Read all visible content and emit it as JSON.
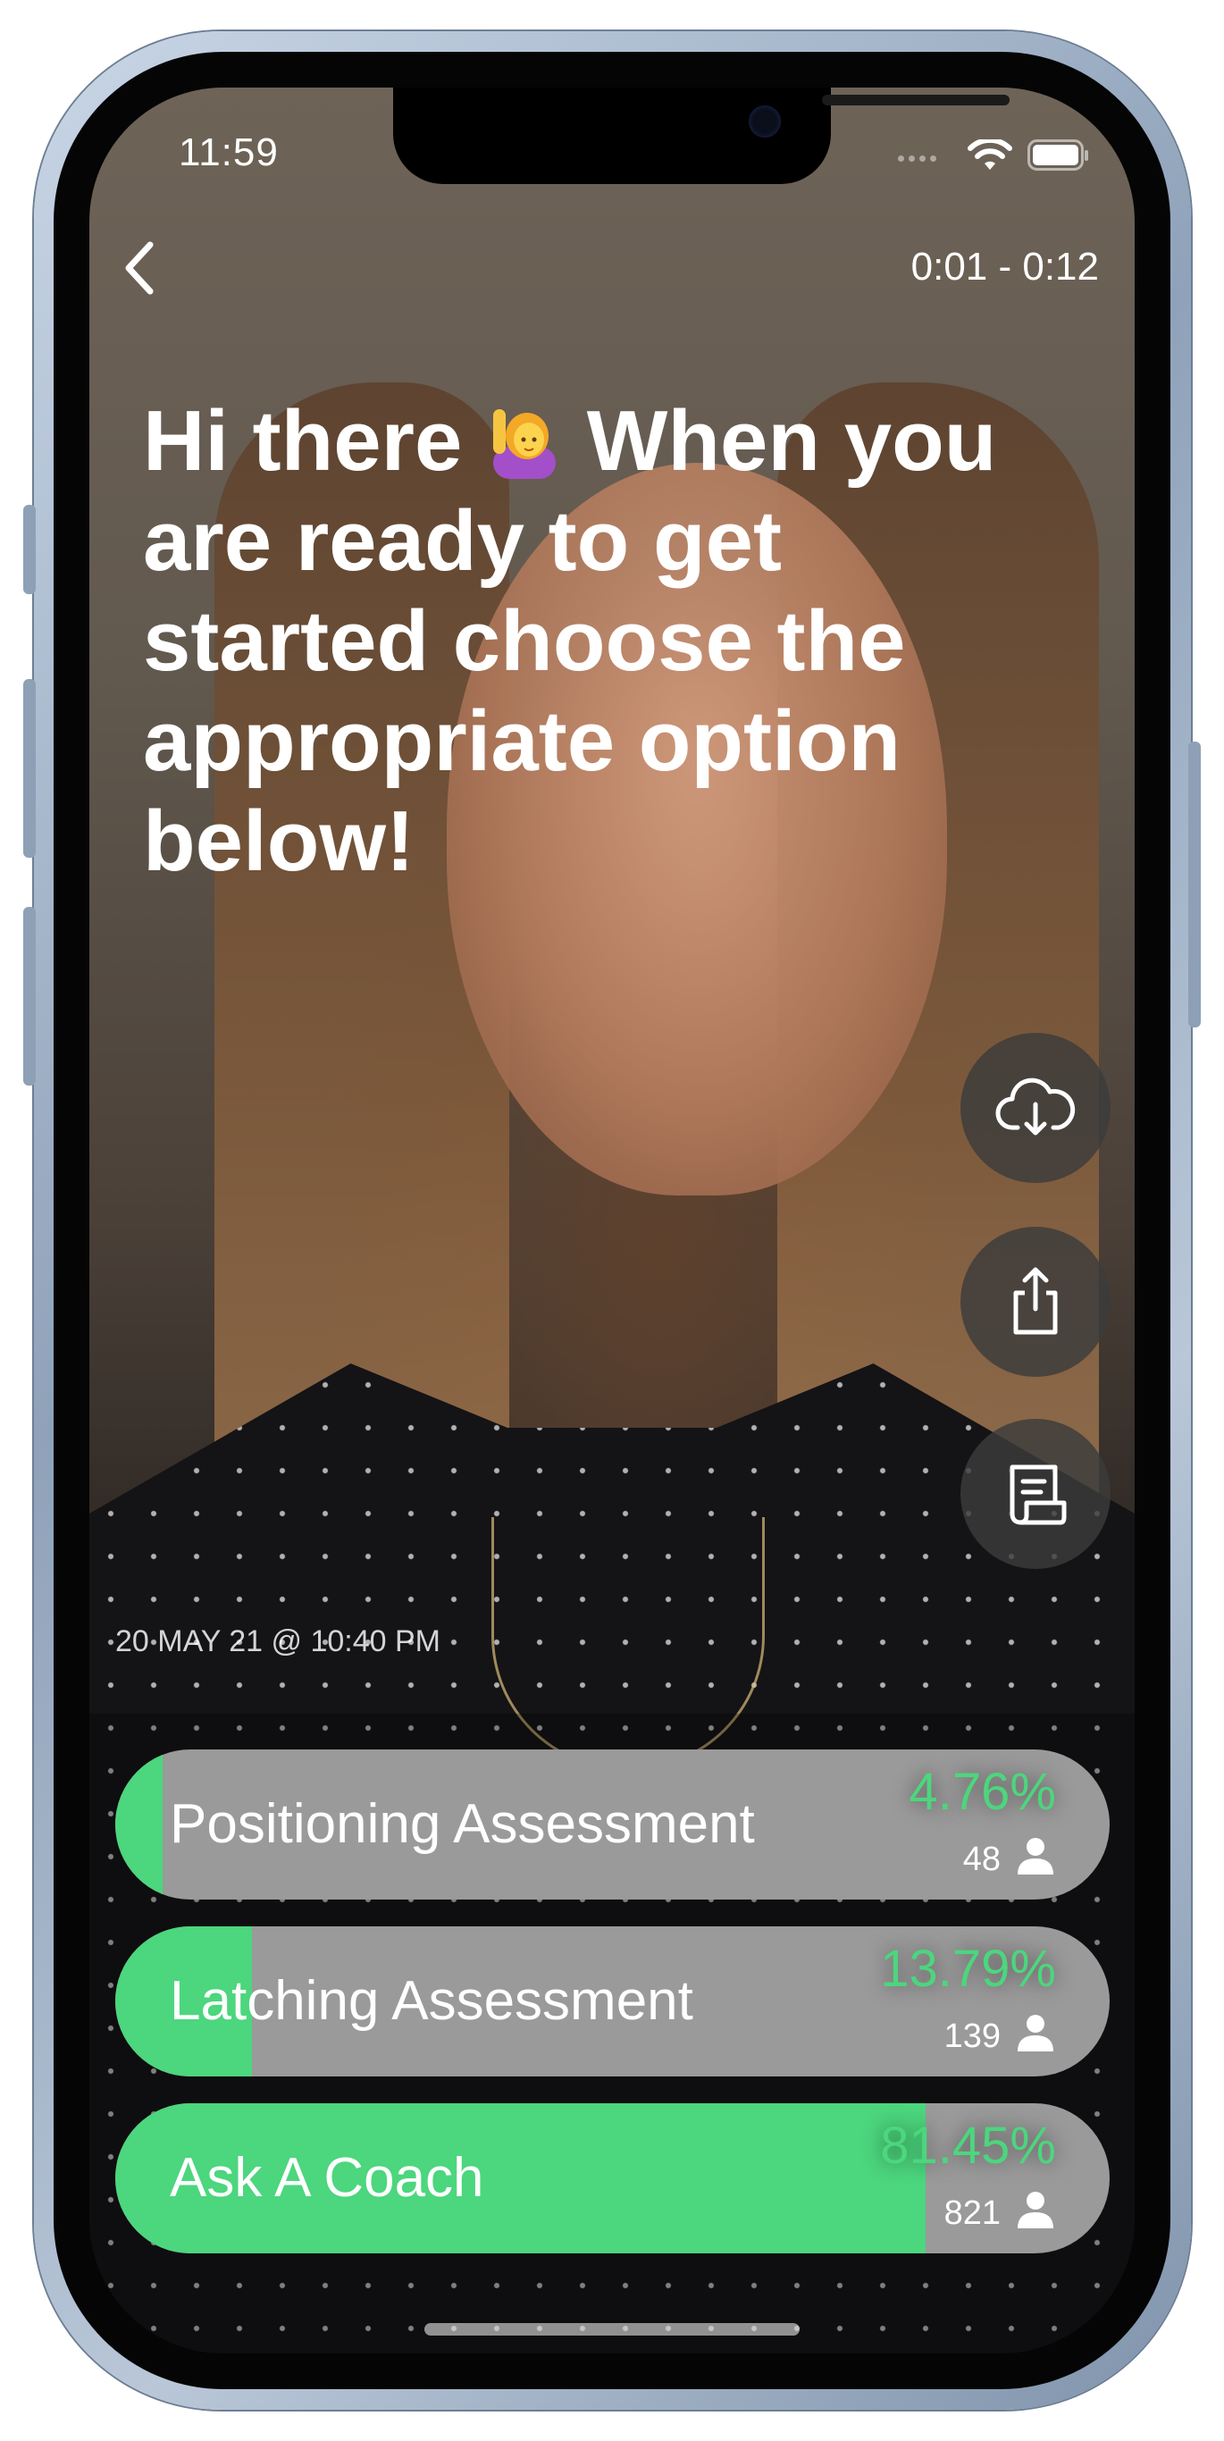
{
  "status_bar": {
    "time": "11:59"
  },
  "video": {
    "timecode": "0:01 - 0:12",
    "headline_part1": "Hi there",
    "headline_part2": "When you are ready to get started choose the appropriate option below!",
    "emoji": "person-raising-hand-emoji",
    "timestamp": "20 MAY 21 @ 10:40 PM"
  },
  "actions": [
    {
      "icon": "cloud-download-icon"
    },
    {
      "icon": "share-icon"
    },
    {
      "icon": "transcript-icon"
    }
  ],
  "poll": {
    "accent_color": "#4cd67d",
    "options": [
      {
        "label": "Positioning Assessment",
        "percent": "4.76%",
        "count": "48",
        "fill": 0.0476
      },
      {
        "label": "Latching Assessment",
        "percent": "13.79%",
        "count": "139",
        "fill": 0.1379
      },
      {
        "label": "Ask A Coach",
        "percent": "81.45%",
        "count": "821",
        "fill": 0.8145
      }
    ]
  }
}
